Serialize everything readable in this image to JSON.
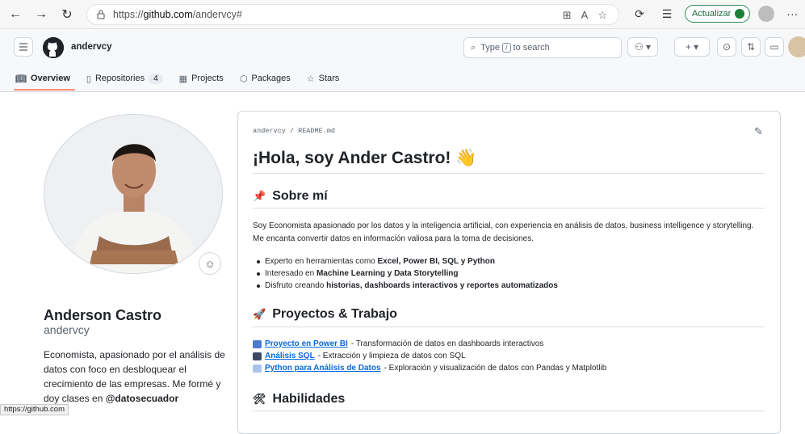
{
  "browser": {
    "url_prefix": "https://",
    "url_domain": "github.com",
    "url_path": "/andervcy#",
    "update_label": "Actualizar",
    "more": "···"
  },
  "header": {
    "username": "andervcy",
    "search_placeholder_pre": "Type",
    "search_key": "/",
    "search_placeholder_post": "to search"
  },
  "tabs": [
    {
      "label": "Overview",
      "icon": "book-icon"
    },
    {
      "label": "Repositories",
      "icon": "repo-icon",
      "count": "4"
    },
    {
      "label": "Projects",
      "icon": "table-icon"
    },
    {
      "label": "Packages",
      "icon": "package-icon"
    },
    {
      "label": "Stars",
      "icon": "star-icon"
    }
  ],
  "profile": {
    "fullname": "Anderson Castro",
    "login": "andervcy",
    "bio": "Economista, apasionado por el análisis de datos con foco en desbloquear el crecimiento de las empresas. Me formé y doy clases en",
    "bio_handle": "@datosecuador"
  },
  "readme": {
    "crumb": "andervcy / README.md",
    "title": "¡Hola, soy Ander Castro!",
    "title_emoji": "👋",
    "about_heading": "Sobre mí",
    "about_emoji": "📌",
    "about_text": "Soy Economista apasionado por los datos y la inteligencia artificial, con experiencia en análisis de datos, business intelligence y storytelling. Me encanta convertir datos en información valiosa para la toma de decisiones.",
    "bullets": [
      {
        "pre": "Experto en herramientas como ",
        "bold": "Excel, Power BI, SQL y Python"
      },
      {
        "pre": "Interesado en ",
        "bold": "Machine Learning y Data Storytelling"
      },
      {
        "pre": "Disfruto creando ",
        "bold": "historias, dashboards interactivos y reportes automatizados"
      }
    ],
    "projects_heading": "Proyectos & Trabajo",
    "projects_emoji": "🚀",
    "projects": [
      {
        "link": "Proyecto en Power BI",
        "desc": " - Transformación de datos en dashboards interactivos",
        "icon": "bar-chart-icon"
      },
      {
        "link": "Análisis SQL",
        "desc": " - Extracción y limpieza de datos con SQL",
        "icon": "database-icon"
      },
      {
        "link": "Python para Análisis de Datos",
        "desc": " - Exploración y visualización de datos con Pandas y Matplotlib",
        "icon": "chart-up-icon"
      }
    ],
    "skills_heading": "Habilidades",
    "skills_emoji": "🛠"
  },
  "status_bar": "https://github.com",
  "colors": {
    "accent_link": "#0969da",
    "tab_underline": "#fd8c73",
    "update_green": "#1a7f37"
  }
}
